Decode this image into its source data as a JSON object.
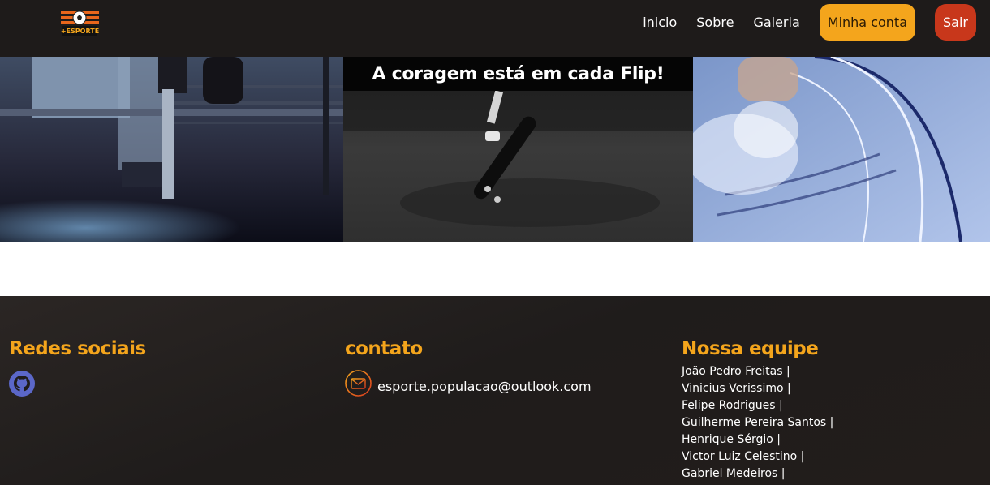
{
  "header": {
    "logo_text": "+ESPORTE",
    "nav": [
      "inicio",
      "Sobre",
      "Galeria"
    ],
    "account_button": "Minha conta",
    "exit_button": "Sair"
  },
  "banner": {
    "caption": "A coragem está em cada Flip!"
  },
  "footer": {
    "social_title": "Redes sociais",
    "contact_title": "contato",
    "email": "esporte.populacao@outlook.com",
    "team_title": "Nossa equipe",
    "team": [
      "João Pedro Freitas |",
      "Vinicius Verissimo |",
      "Felipe Rodrigues |",
      "Guilherme Pereira Santos |",
      "Henrique Sérgio |",
      "Victor Luiz Celestino |",
      "Gabriel Medeiros |"
    ]
  },
  "colors": {
    "header_bg": "#1e1b1a",
    "accent": "#f4a51c",
    "exit": "#c8371b"
  }
}
